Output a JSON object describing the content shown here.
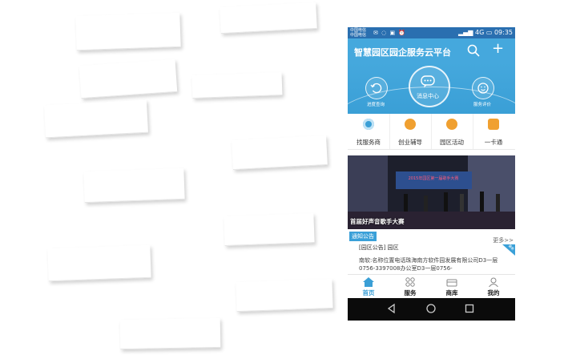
{
  "status_bar": {
    "carrier_line1": "中国电信",
    "carrier_line2": "中国电信",
    "network": "4G",
    "time": "09:35"
  },
  "app_bar": {
    "title": "智慧园区园企服务云平台",
    "search_icon": "search-icon",
    "add_icon": "plus-icon"
  },
  "hero": {
    "left_label": "进度查询",
    "center_label": "消息中心",
    "right_label": "服务评价",
    "icons": [
      "refresh-icon",
      "chat-bubble-icon",
      "smile-icon"
    ]
  },
  "quick_menu": [
    {
      "label": "找服务商",
      "icon": "service-provider-icon",
      "color": "#3a9fd6"
    },
    {
      "label": "创业辅导",
      "icon": "mentoring-icon",
      "color": "#f0a030"
    },
    {
      "label": "园区活动",
      "icon": "activity-icon",
      "color": "#f0a030"
    },
    {
      "label": "一卡通",
      "icon": "card-icon",
      "color": "#f0a030"
    }
  ],
  "banner": {
    "caption": "首届好声音歌手大赛",
    "sign_text": "2015年园区第一届歌手大赛"
  },
  "notice": {
    "tag": "通知公告",
    "more": "更多>>",
    "headline": "[园区公告]  园区",
    "ribbon": "最新",
    "body": "南软:名称位置电话珠海南方软件园发展有限公司D3一层0756-3397008办公室D3一层0756-"
  },
  "tabs": [
    {
      "label": "首页",
      "icon": "home-icon",
      "active": true
    },
    {
      "label": "服务",
      "icon": "grid-icon",
      "active": false
    },
    {
      "label": "商库",
      "icon": "store-icon",
      "active": false
    },
    {
      "label": "我的",
      "icon": "person-icon",
      "active": false
    }
  ],
  "nav_buttons": [
    "back-icon",
    "home-circle-icon",
    "recent-apps-icon"
  ],
  "colors": {
    "primary": "#45a8dd",
    "status_bar": "#2a6fb0",
    "accent_orange": "#f0a030",
    "nav_bar": "#0b0b0b"
  }
}
